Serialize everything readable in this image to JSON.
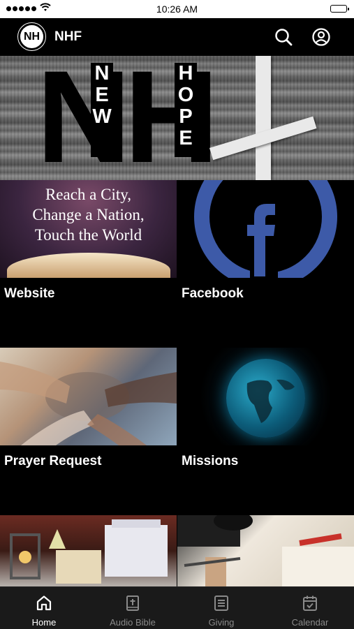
{
  "status_bar": {
    "time": "10:26 AM"
  },
  "header": {
    "logo_text": "NH",
    "title": "NHF"
  },
  "banner": {
    "big_letters": "NH",
    "word_left": "NEW",
    "word_right": "HOPE"
  },
  "tiles": [
    {
      "label": "Website",
      "motto": [
        "Reach a City,",
        "Change a Nation,",
        "Touch the World"
      ]
    },
    {
      "label": "Facebook",
      "icon_letter": "f"
    },
    {
      "label": "Prayer Request"
    },
    {
      "label": "Missions"
    },
    {
      "label": ""
    },
    {
      "label": ""
    }
  ],
  "tabs": [
    {
      "label": "Home",
      "icon": "home-icon",
      "active": true
    },
    {
      "label": "Audio Bible",
      "icon": "bible-icon"
    },
    {
      "label": "Giving",
      "icon": "giving-icon"
    },
    {
      "label": "Calendar",
      "icon": "calendar-icon"
    }
  ],
  "colors": {
    "facebook": "#3d5aa8",
    "background": "#000000",
    "tabbar": "#1a1a1a"
  }
}
